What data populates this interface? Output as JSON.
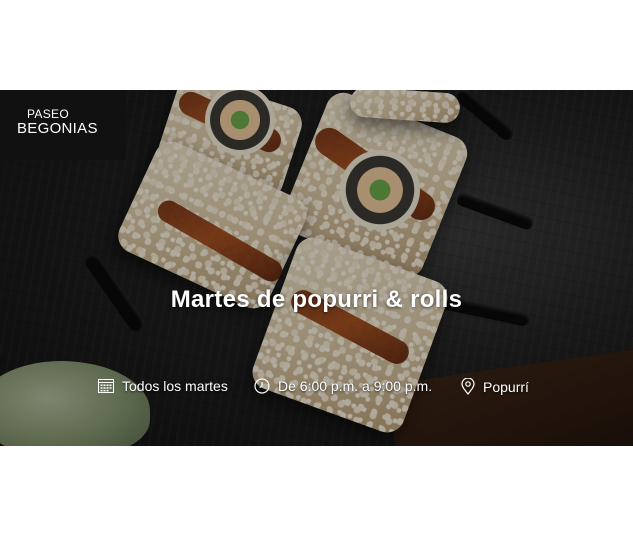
{
  "brand": {
    "line1": "PASEO",
    "line2": "BEGONIAS"
  },
  "event": {
    "title": "Martes de popurri & rolls",
    "when": "Todos los martes",
    "time": "De 6:00 p.m. a 9:00 p.m.",
    "place": "Popurrí"
  },
  "icons": {
    "when": "calendar-icon",
    "time": "clock-icon",
    "place": "location-pin-icon"
  },
  "colors": {
    "logo_bg": "#111111",
    "text": "#ffffff"
  }
}
